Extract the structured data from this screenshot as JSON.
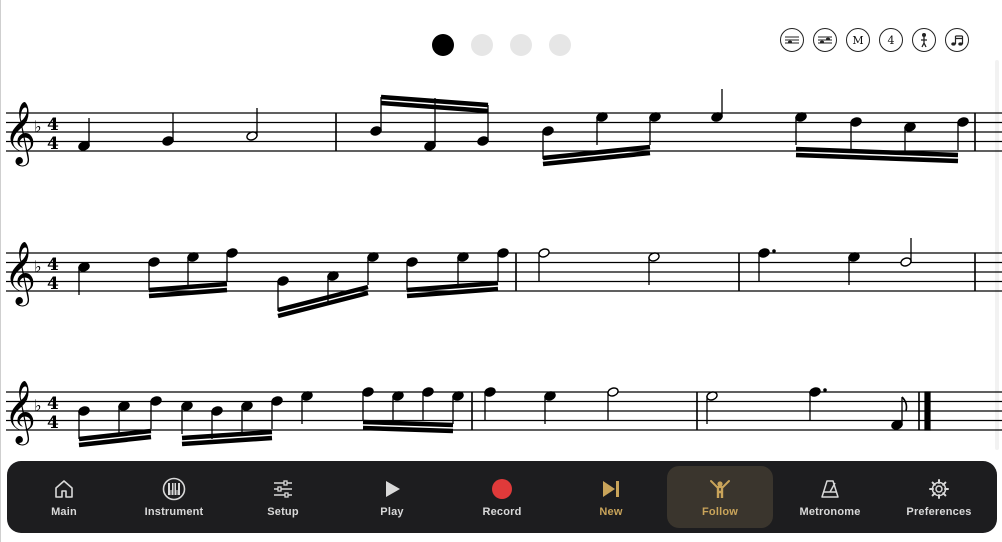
{
  "pager": {
    "pages": 4,
    "current_page": 1
  },
  "toolbar_icons": [
    {
      "name": "notes-view-icon"
    },
    {
      "name": "score-view-icon"
    },
    {
      "name": "metronome-mark-icon",
      "glyph": "M"
    },
    {
      "name": "time-signature-icon",
      "glyph": "4"
    },
    {
      "name": "person-icon"
    },
    {
      "name": "sixteenth-notes-icon"
    }
  ],
  "score": {
    "clef": "treble",
    "key_signature": "one flat",
    "time_signature": "4/4"
  },
  "nav": {
    "items": [
      {
        "label": "Main",
        "icon": "home-icon"
      },
      {
        "label": "Instrument",
        "icon": "piano-keys-icon"
      },
      {
        "label": "Setup",
        "icon": "sliders-icon"
      },
      {
        "label": "Play",
        "icon": "play-icon"
      },
      {
        "label": "Record",
        "icon": "record-icon"
      },
      {
        "label": "New",
        "icon": "skip-next-icon"
      },
      {
        "label": "Follow",
        "icon": "conductor-icon"
      },
      {
        "label": "Metronome",
        "icon": "metronome-icon"
      },
      {
        "label": "Preferences",
        "icon": "gear-icon"
      }
    ],
    "selected": "Follow",
    "colors": {
      "accent": "#c9a45a",
      "record": "#e03a3a",
      "bar_bg": "#1d1d1f",
      "selected_bg": "#3a352d"
    }
  }
}
